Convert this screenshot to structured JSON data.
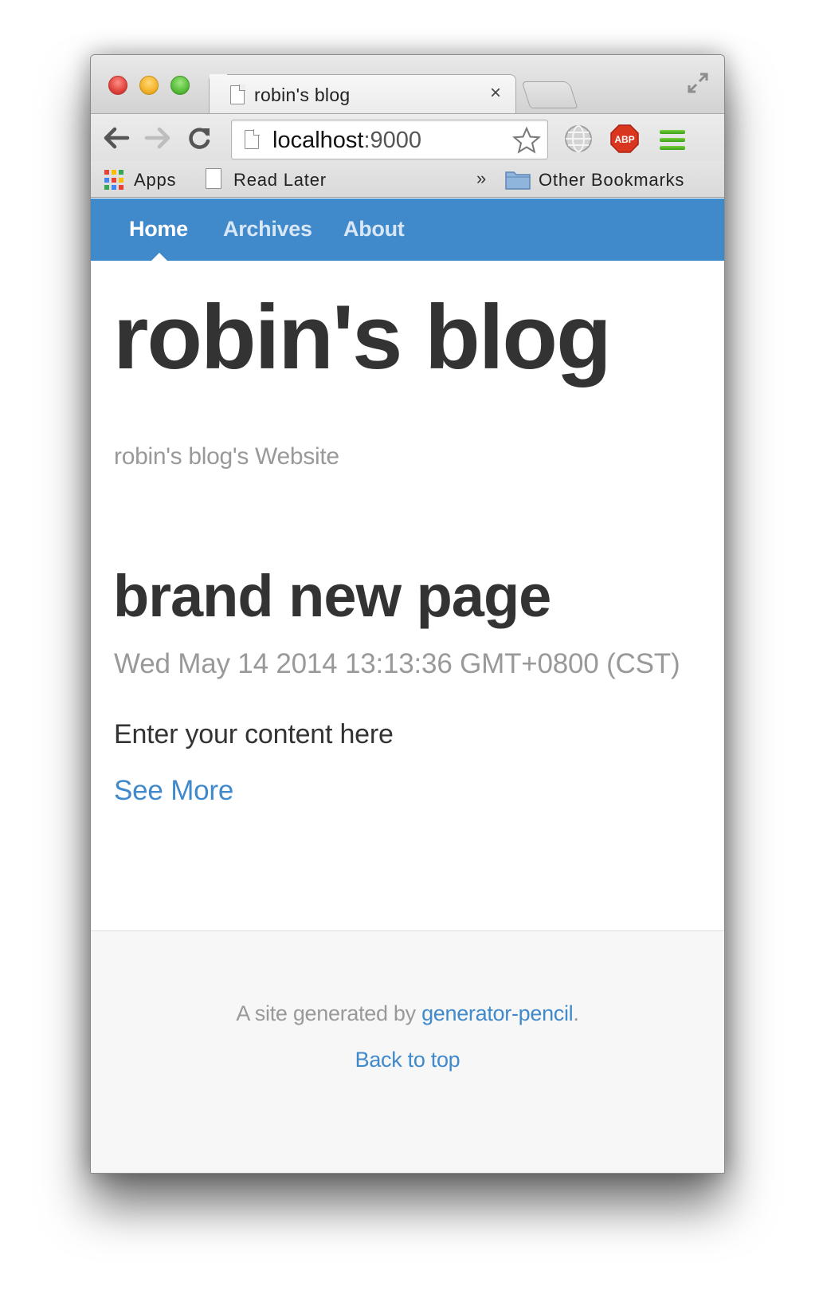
{
  "browser": {
    "tab": {
      "title": "robin's blog",
      "close_glyph": "×"
    },
    "address": {
      "host": "localhost",
      "port": ":9000"
    },
    "bookmarks": {
      "apps_label": "Apps",
      "read_later_label": "Read Later",
      "overflow_glyph": "»",
      "other_label": "Other Bookmarks"
    },
    "extensions": {
      "abp_label": "ABP"
    }
  },
  "site": {
    "nav": [
      {
        "label": "Home",
        "active": true
      },
      {
        "label": "Archives",
        "active": false
      },
      {
        "label": "About",
        "active": false
      }
    ],
    "title": "robin's blog",
    "subtitle": "robin's blog's Website",
    "accent_color": "#4089cb"
  },
  "post": {
    "title": "brand new page",
    "date": "Wed May 14 2014 13:13:36 GMT+0800 (CST)",
    "body": "Enter your content here",
    "see_more_label": "See More"
  },
  "footer": {
    "generated_prefix": "A site generated by ",
    "generator_link": "generator-pencil",
    "generated_suffix": ".",
    "back_to_top": "Back to top"
  },
  "icons": [
    "document-icon",
    "close-icon",
    "back-arrow-icon",
    "forward-arrow-icon",
    "reload-icon",
    "star-icon",
    "globe-icon",
    "adblock-icon",
    "menu-icon",
    "apps-grid-icon",
    "folder-icon",
    "fullscreen-icon"
  ]
}
